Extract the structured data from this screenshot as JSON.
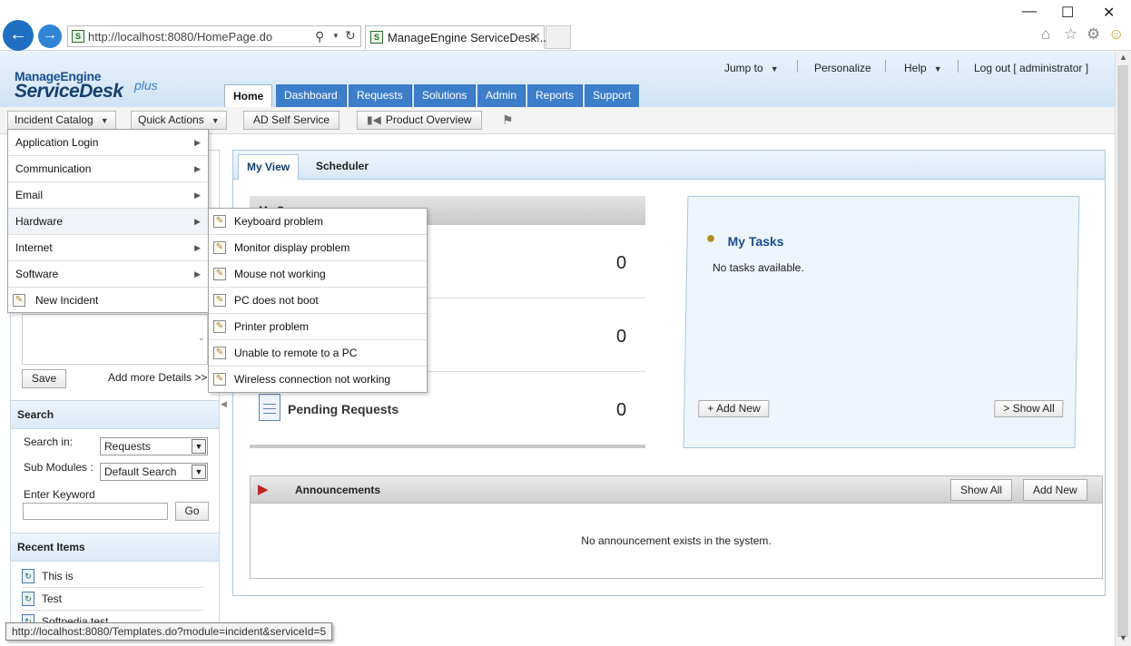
{
  "browser": {
    "address": "http://localhost:8080/HomePage.do",
    "tab_title": "ManageEngine ServiceDesk...",
    "status_url": "http://localhost:8080/Templates.do?module=incident&serviceId=5"
  },
  "logo": {
    "line1": "ManageEngine",
    "line2": "ServiceDesk",
    "line3": "plus"
  },
  "top_links": {
    "jump_to": "Jump to",
    "personalize": "Personalize",
    "help": "Help",
    "logout": "Log out [ administrator ]"
  },
  "main_tabs": [
    "Home",
    "Dashboard",
    "Requests",
    "Solutions",
    "Admin",
    "Reports",
    "Support"
  ],
  "toolbar": {
    "incident_catalog": "Incident Catalog",
    "quick_actions": "Quick Actions",
    "ad_self_service": "AD Self Service",
    "product_overview": "Product Overview"
  },
  "catalog_menu": [
    "Application Login",
    "Communication",
    "Email",
    "Hardware",
    "Internet",
    "Software",
    "New Incident"
  ],
  "hardware_menu": [
    "Keyboard problem",
    "Monitor display problem",
    "Mouse not working",
    "PC does not boot",
    "Printer problem",
    "Unable to remote to a PC",
    "Wireless connection not working"
  ],
  "left": {
    "save": "Save",
    "add_more": "Add more Details >>",
    "search_title": "Search",
    "search_in_label": "Search in:",
    "search_in_value": "Requests",
    "sub_modules_label": "Sub Modules :",
    "sub_modules_value": "Default Search",
    "keyword_label": "Enter Keyword",
    "go": "Go",
    "recent_title": "Recent Items",
    "recent": [
      "This is",
      "Test",
      "Softpedia test"
    ]
  },
  "main": {
    "tab_myview": "My View",
    "tab_scheduler": "Scheduler",
    "summary_head": "My S",
    "counts": [
      "0",
      "0",
      "0"
    ],
    "pending_label": "Pending Requests",
    "tasks_title": "My Tasks",
    "tasks_empty": "No tasks available.",
    "add_new": "+ Add New",
    "show_all": "> Show All",
    "ann_title": "Announcements",
    "ann_show_all": "Show All",
    "ann_add_new": "Add New",
    "ann_empty": "No announcement exists in the system."
  }
}
